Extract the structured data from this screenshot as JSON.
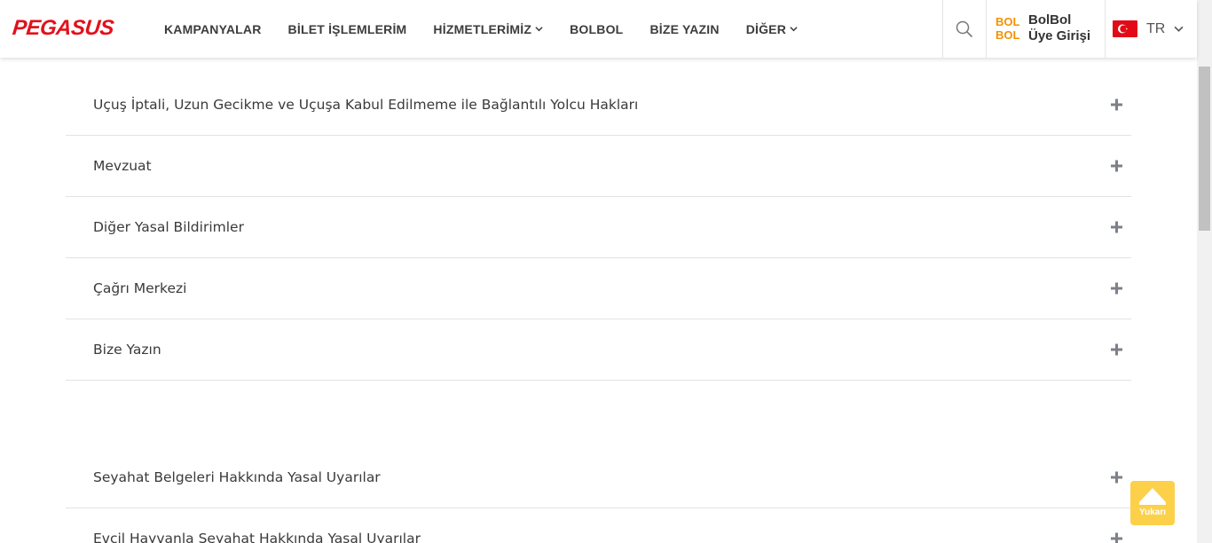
{
  "header": {
    "logo_text": "PEGASUS",
    "nav": [
      {
        "label": "KAMPANYALAR",
        "dropdown": false
      },
      {
        "label": "BİLET İŞLEMLERİM",
        "dropdown": false
      },
      {
        "label": "HİZMETLERİMİZ",
        "dropdown": true
      },
      {
        "label": "BOLBOL",
        "dropdown": false
      },
      {
        "label": "BİZE YAZIN",
        "dropdown": false
      },
      {
        "label": "DİĞER",
        "dropdown": true
      }
    ],
    "search_icon": "search-icon",
    "bolbol": {
      "mark_line1": "BOL",
      "mark_line2": "BOL",
      "line1": "BolBol",
      "line2": "Üye Girişi"
    },
    "language": {
      "code": "TR",
      "flag": "turkey-flag-icon"
    }
  },
  "accordion_top": [
    {
      "label": "Uçuş İptali, Uzun Gecikme ve Uçuşa Kabul Edilmeme ile Bağlantılı Yolcu Hakları"
    },
    {
      "label": "Mevzuat"
    },
    {
      "label": "Diğer Yasal Bildirimler"
    },
    {
      "label": "Çağrı Merkezi"
    },
    {
      "label": "Bize Yazın"
    }
  ],
  "accordion_bottom": [
    {
      "label": "Seyahat Belgeleri Hakkında Yasal Uyarılar"
    },
    {
      "label": "Evcil Hayvanla Seyahat Hakkında Yasal Uyarılar"
    }
  ],
  "back_to_top": {
    "label": "Yukarı"
  },
  "colors": {
    "brand_red": "#e2111c",
    "bolbol_orange": "#f39200",
    "back_to_top_yellow": "#fdd04a",
    "plus_gray": "#7d8187"
  }
}
